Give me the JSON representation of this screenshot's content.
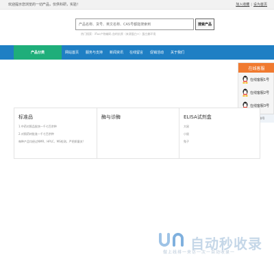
{
  "topbar": {
    "welcome": "欢迎提示您浏览的一切产品，仅供科研，实验！",
    "join_fav": "加入收藏",
    "set_home": "设为首页"
  },
  "search": {
    "placeholder": "产品名称、货号、英文名称、CAS号都能搜索到",
    "button": "搜索产品",
    "hot": "热门搜索：ifluo产物编码 血的抗原（来源蛋白+）蛋白兼环境"
  },
  "nav": {
    "category": "产品分类",
    "items": [
      "网站首页",
      "服务与支持",
      "新闻资讯",
      "在线留言",
      "促销活动",
      "关于我们"
    ]
  },
  "support": {
    "title": "在线客服",
    "agents": [
      "在线客服1号",
      "在线客服2号",
      "在线客服3号"
    ],
    "footer": "微信公众帐号"
  },
  "categories": [
    {
      "title": "标准品",
      "subs": [
        "1.中药对照品批快一千七百余种",
        "2.对照药材批准一千七百余种",
        "每种产品均经过NMR、HPLC、MS检测，严把质量关!"
      ]
    },
    {
      "title": "酶与诊酶",
      "subs": []
    },
    {
      "title": "ELISA试剂盒",
      "subs": [
        "大鼠",
        "小鼠",
        "兔子"
      ]
    }
  ],
  "watermark": {
    "name": "自动秒收录",
    "slogan": "做上线排一来访一次一自动收录一"
  }
}
